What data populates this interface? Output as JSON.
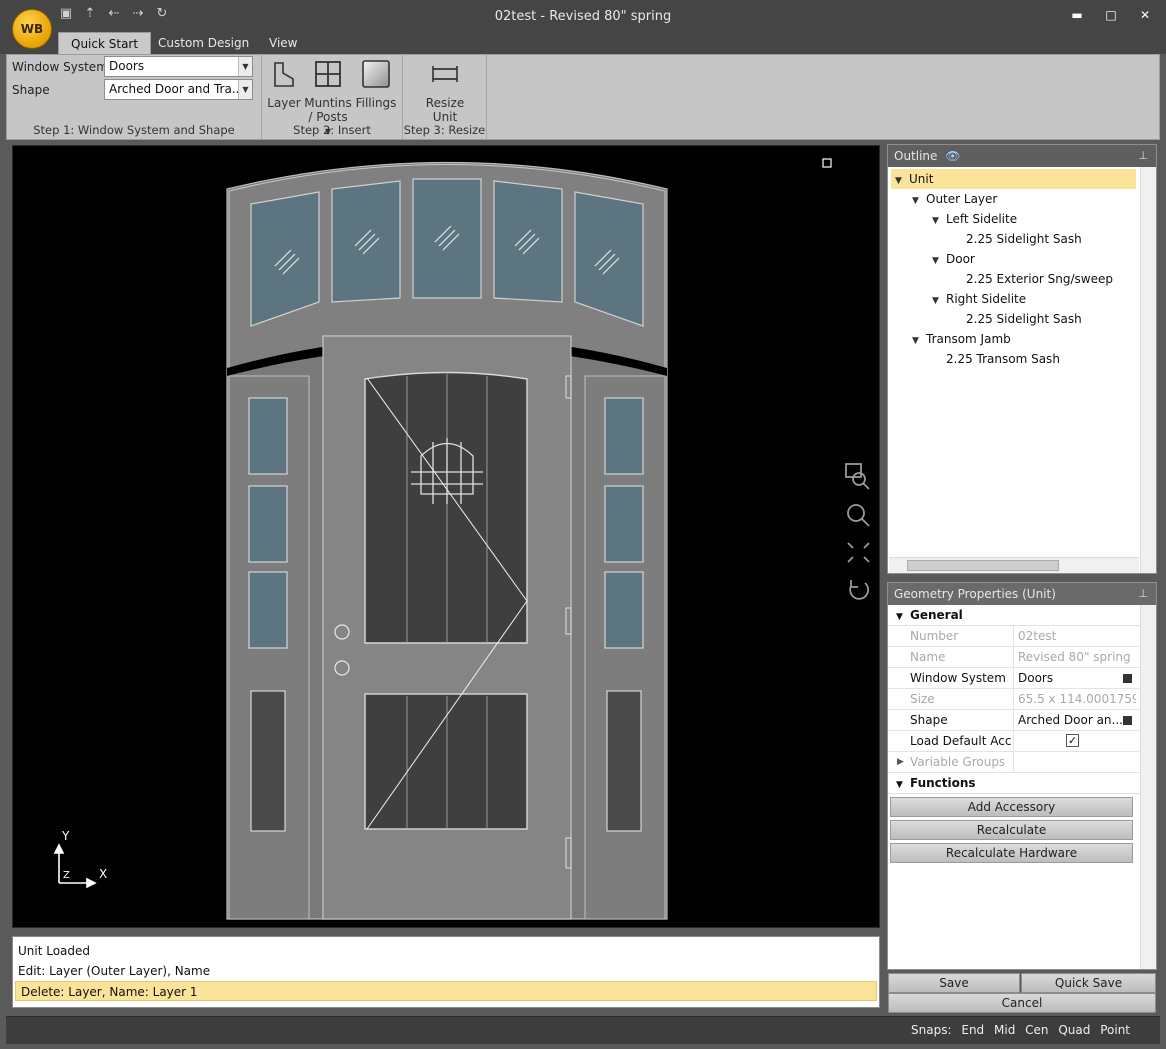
{
  "app": {
    "logo_text": "WB",
    "title": "02test - Revised 80\" spring"
  },
  "quick_access": [
    "save-icon",
    "upload-icon",
    "undo-icon",
    "redo-icon",
    "refresh-icon"
  ],
  "window_controls": [
    "minimize-icon",
    "maximize-icon",
    "close-icon"
  ],
  "tabs": [
    {
      "label": "Quick Start",
      "active": true
    },
    {
      "label": "Custom Design",
      "active": false
    },
    {
      "label": "View",
      "active": false
    }
  ],
  "ribbon": {
    "step1": {
      "label": "Step 1: Window System and Shape",
      "window_system_label": "Window System",
      "window_system_value": "Doors",
      "shape_label": "Shape",
      "shape_value": "Arched Door and Tra..."
    },
    "step2": {
      "label": "Step 2: Insert",
      "layer": "Layer",
      "muntins_line1": "Muntins",
      "muntins_line2": "/ Posts ▾",
      "fillings": "Fillings"
    },
    "step3": {
      "label": "Step 3: Resize",
      "resize_line1": "Resize",
      "resize_line2": "Unit"
    }
  },
  "canvas": {
    "axis_y": "Y",
    "axis_x": "X",
    "axis_z": "Z",
    "view_tools": [
      "zoom-window-icon",
      "zoom-icon",
      "fit-extents-icon",
      "reset-view-icon"
    ]
  },
  "log": [
    {
      "text": "Unit Loaded",
      "selected": false
    },
    {
      "text": "Edit: Layer (Outer Layer), Name",
      "selected": false
    },
    {
      "text": "Delete: Layer, Name: Layer 1",
      "selected": true
    }
  ],
  "outline": {
    "title": "Outline",
    "nodes": [
      {
        "label": "Unit",
        "level": 0,
        "expanded": true,
        "selected": true
      },
      {
        "label": "Outer Layer",
        "level": 1,
        "expanded": true,
        "selected": false
      },
      {
        "label": "Left Sidelite",
        "level": 2,
        "expanded": true,
        "selected": false
      },
      {
        "label": "2.25 Sidelight Sash",
        "level": 3,
        "expanded": false,
        "selected": false
      },
      {
        "label": "Door",
        "level": 2,
        "expanded": true,
        "selected": false
      },
      {
        "label": "2.25 Exterior Sng/sweep",
        "level": 3,
        "expanded": false,
        "selected": false
      },
      {
        "label": "Right Sidelite",
        "level": 2,
        "expanded": true,
        "selected": false
      },
      {
        "label": "2.25 Sidelight Sash",
        "level": 3,
        "expanded": false,
        "selected": false
      },
      {
        "label": "Transom Jamb",
        "level": 1,
        "expanded": true,
        "selected": false
      },
      {
        "label": "2.25 Transom Sash",
        "level": 2,
        "expanded": false,
        "selected": false
      }
    ]
  },
  "geometry": {
    "title": "Geometry Properties (Unit)",
    "general_label": "General",
    "rows": [
      {
        "key": "Number",
        "value": "02test",
        "disabled": true,
        "type": "text"
      },
      {
        "key": "Name",
        "value": "Revised 80\" spring",
        "disabled": true,
        "type": "text"
      },
      {
        "key": "Window System",
        "value": "Doors",
        "disabled": false,
        "type": "picker"
      },
      {
        "key": "Size",
        "value": "65.5  x  114.0001759...",
        "disabled": true,
        "type": "text"
      },
      {
        "key": "Shape",
        "value": "Arched Door an...",
        "disabled": false,
        "type": "picker"
      },
      {
        "key": "Load Default Acc...",
        "value": "✓",
        "disabled": false,
        "type": "checkbox"
      },
      {
        "key": "Variable Groups",
        "value": "",
        "disabled": true,
        "type": "group"
      }
    ],
    "functions_label": "Functions",
    "buttons": [
      "Add Accessory",
      "Recalculate",
      "Recalculate Hardware"
    ]
  },
  "footer_buttons": {
    "save": "Save",
    "quick_save": "Quick Save",
    "cancel": "Cancel"
  },
  "status": {
    "snaps_label": "Snaps:",
    "snaps": [
      "End",
      "Mid",
      "Cen",
      "Quad",
      "Point"
    ]
  }
}
